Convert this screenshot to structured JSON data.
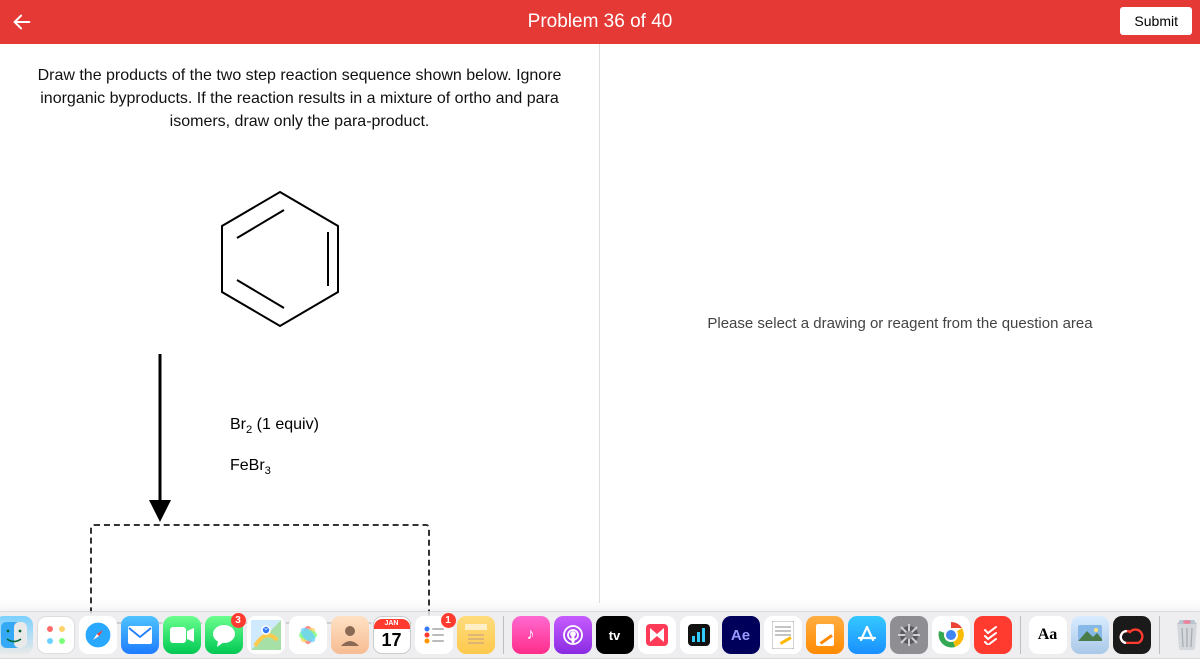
{
  "topbar": {
    "title": "Problem 36 of 40",
    "submit_label": "Submit"
  },
  "question": {
    "prompt": "Draw the products of the two step reaction sequence shown below. Ignore inorganic byproducts. If the reaction results in a mixture of ortho and para isomers, draw only the para-product.",
    "reagent1_prefix": "Br",
    "reagent1_sub": "2",
    "reagent1_suffix": " (1 equiv)",
    "reagent2_prefix": "FeBr",
    "reagent2_sub": "3"
  },
  "right": {
    "placeholder": "Please select a drawing or reagent from the question area"
  },
  "dock": {
    "calendar_month": "JAN",
    "calendar_day": "17",
    "messages_badge": "3",
    "reminders_badge": "1"
  }
}
